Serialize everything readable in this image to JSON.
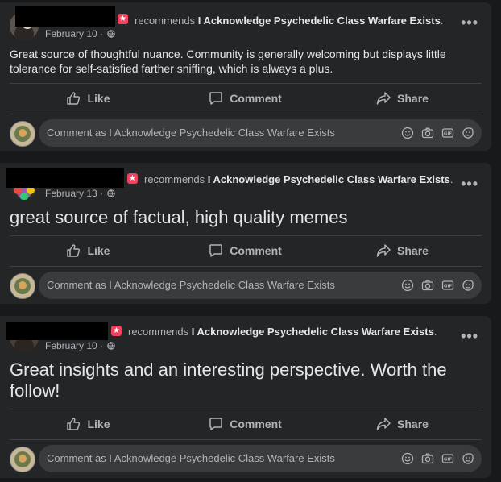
{
  "posts": [
    {
      "recommends_label": "recommends",
      "page_name": "I Acknowledge Psychedelic Class Warfare Exists",
      "date": "February 10",
      "text": "Great source of thoughtful nuance. Community is generally welcoming but displays little tolerance for self-satisfied farther sniffing, which is always a plus."
    },
    {
      "recommends_label": "recommends",
      "page_name": "I Acknowledge Psychedelic Class Warfare Exists",
      "date": "February 13",
      "text": "great source of factual, high quality memes"
    },
    {
      "recommends_label": "recommends",
      "page_name": "I Acknowledge Psychedelic Class Warfare Exists",
      "date": "February 10",
      "text": "Great insights and an interesting perspective. Worth the follow!"
    }
  ],
  "actions": {
    "like": "Like",
    "comment": "Comment",
    "share": "Share"
  },
  "comment_placeholder": "Comment as I Acknowledge Psychedelic Class Warfare Exists",
  "icons": {
    "more": "more-horizontal-icon",
    "like": "thumbs-up-icon",
    "comment": "speech-bubble-icon",
    "share": "share-arrow-icon",
    "emoji": "emoji-icon",
    "camera": "camera-icon",
    "gif": "gif-icon",
    "sticker": "sticker-icon",
    "globe": "globe-icon",
    "recommend": "recommend-badge-icon"
  },
  "colors": {
    "background": "#18191a",
    "card": "#242526",
    "input": "#3a3b3c",
    "secondary_text": "#b0b3b8",
    "primary_text": "#e4e6eb",
    "recommend_badge": "#f3425f"
  }
}
